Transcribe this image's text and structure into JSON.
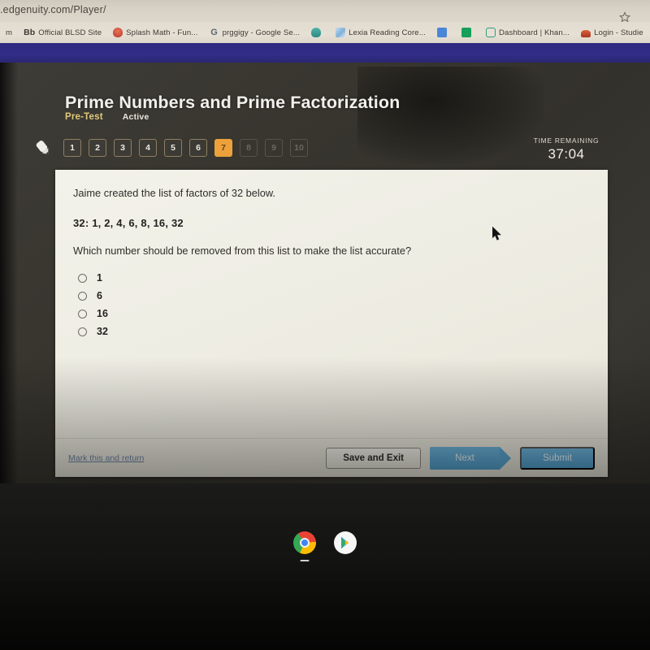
{
  "browser": {
    "url": ".edgenuity.com/Player/",
    "star_icon": "star-bookmark-icon",
    "bookmarks": [
      {
        "label": "m",
        "icon": "generic-favicon",
        "color": "#8a8378"
      },
      {
        "label": "Official BLSD Site",
        "icon": "blackboard-icon",
        "color": "#2b2b2b",
        "bold": true,
        "badge": "Bb"
      },
      {
        "label": "Splash Math - Fun...",
        "icon": "splash-math-icon",
        "color": "#c0392b"
      },
      {
        "label": "prggigy - Google Se...",
        "icon": "google-g-icon",
        "color": "#4285f4"
      },
      {
        "label": "",
        "icon": "teal-owl-icon",
        "color": "#3aa39a"
      },
      {
        "label": "Lexia Reading Core...",
        "icon": "lexia-icon",
        "color": "#6aa7d8"
      },
      {
        "label": "",
        "icon": "google-docs-icon",
        "color": "#4285f4"
      },
      {
        "label": "",
        "icon": "google-sheets-icon",
        "color": "#0f9d58"
      },
      {
        "label": "Dashboard | Khan...",
        "icon": "khan-academy-icon",
        "color": "#14bf96"
      },
      {
        "label": "Login - Studie",
        "icon": "login-icon",
        "color": "#c0392b"
      }
    ]
  },
  "app": {
    "title": "Prime Numbers and Prime Factorization",
    "assessment_type": "Pre-Test",
    "status": "Active",
    "pencil_icon": "pencil-tool-icon",
    "accent_current": "#eda13b",
    "questions": [
      {
        "n": "1",
        "state": "available"
      },
      {
        "n": "2",
        "state": "available"
      },
      {
        "n": "3",
        "state": "available"
      },
      {
        "n": "4",
        "state": "available"
      },
      {
        "n": "5",
        "state": "available"
      },
      {
        "n": "6",
        "state": "available"
      },
      {
        "n": "7",
        "state": "current"
      },
      {
        "n": "8",
        "state": "locked"
      },
      {
        "n": "9",
        "state": "locked"
      },
      {
        "n": "10",
        "state": "locked"
      }
    ],
    "timer": {
      "label": "TIME REMAINING",
      "value": "37:04"
    }
  },
  "question": {
    "stem": "Jaime created the list of factors of 32 below.",
    "factor_list": "32: 1, 2, 4, 6, 8, 16, 32",
    "prompt": "Which number should be removed from this list to make the list accurate?",
    "choices": [
      {
        "label": "1",
        "selected": false
      },
      {
        "label": "6",
        "selected": false
      },
      {
        "label": "16",
        "selected": false
      },
      {
        "label": "32",
        "selected": false
      }
    ]
  },
  "footer": {
    "mark_link": "Mark this and return",
    "save_button": "Save and Exit",
    "next_button": "Next",
    "submit_button": "Submit",
    "button_color": "#58a6d3"
  },
  "shelf": {
    "items": [
      {
        "name": "chrome-icon"
      },
      {
        "name": "play-store-icon"
      }
    ]
  }
}
